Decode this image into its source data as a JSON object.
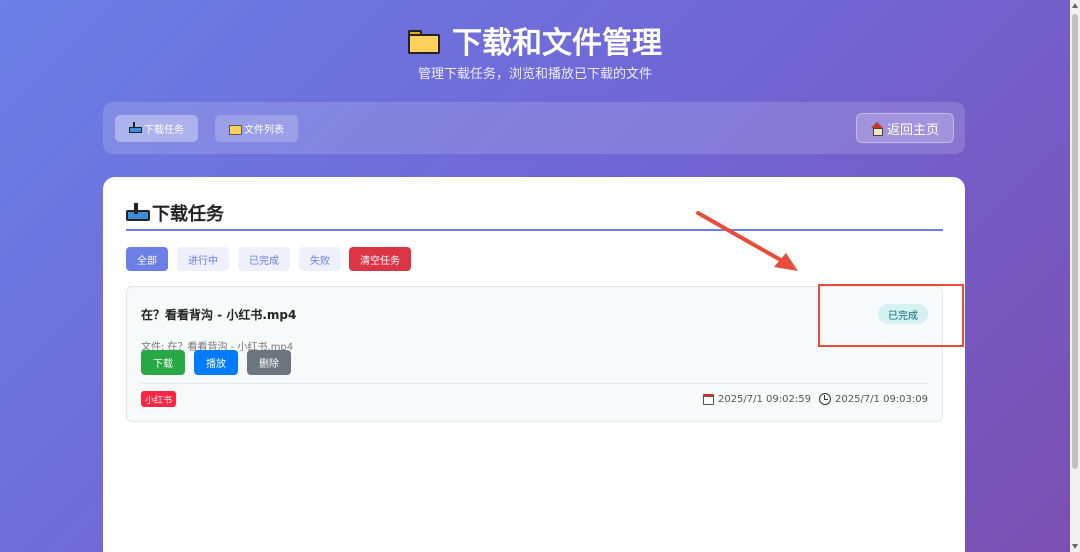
{
  "header": {
    "title": "下载和文件管理",
    "subtitle": "管理下载任务，浏览和播放已下载的文件",
    "title_icon": "folder-icon"
  },
  "nav": {
    "tabs": [
      {
        "label": "下载任务",
        "icon": "inbox-tray-icon",
        "active": true
      },
      {
        "label": "文件列表",
        "icon": "folder-icon",
        "active": false
      }
    ],
    "home_label": "返回主页",
    "home_icon": "house-icon"
  },
  "main": {
    "section_title": "下载任务",
    "section_icon": "inbox-tray-icon",
    "filters": [
      {
        "label": "全部",
        "active": true
      },
      {
        "label": "进行中",
        "active": false
      },
      {
        "label": "已完成",
        "active": false
      },
      {
        "label": "失败",
        "active": false
      }
    ],
    "clear_label": "清空任务",
    "task": {
      "name": "在？看看背沟 - 小红书.mp4",
      "status": "已完成",
      "file_line": "文件: 在？看看背沟 - 小红书.mp4",
      "actions": {
        "download": "下载",
        "play": "播放",
        "delete": "删除"
      },
      "source": "小红书",
      "created_time": "2025/7/1 09:02:59",
      "finished_time": "2025/7/1 09:03:09"
    }
  },
  "colors": {
    "accent": "#6b7fe6",
    "danger": "#dc3545",
    "success": "#28a745",
    "primary": "#007bff",
    "secondary": "#6c757d",
    "source_tag": "#ff2442",
    "annotation": "#e74c3c"
  }
}
